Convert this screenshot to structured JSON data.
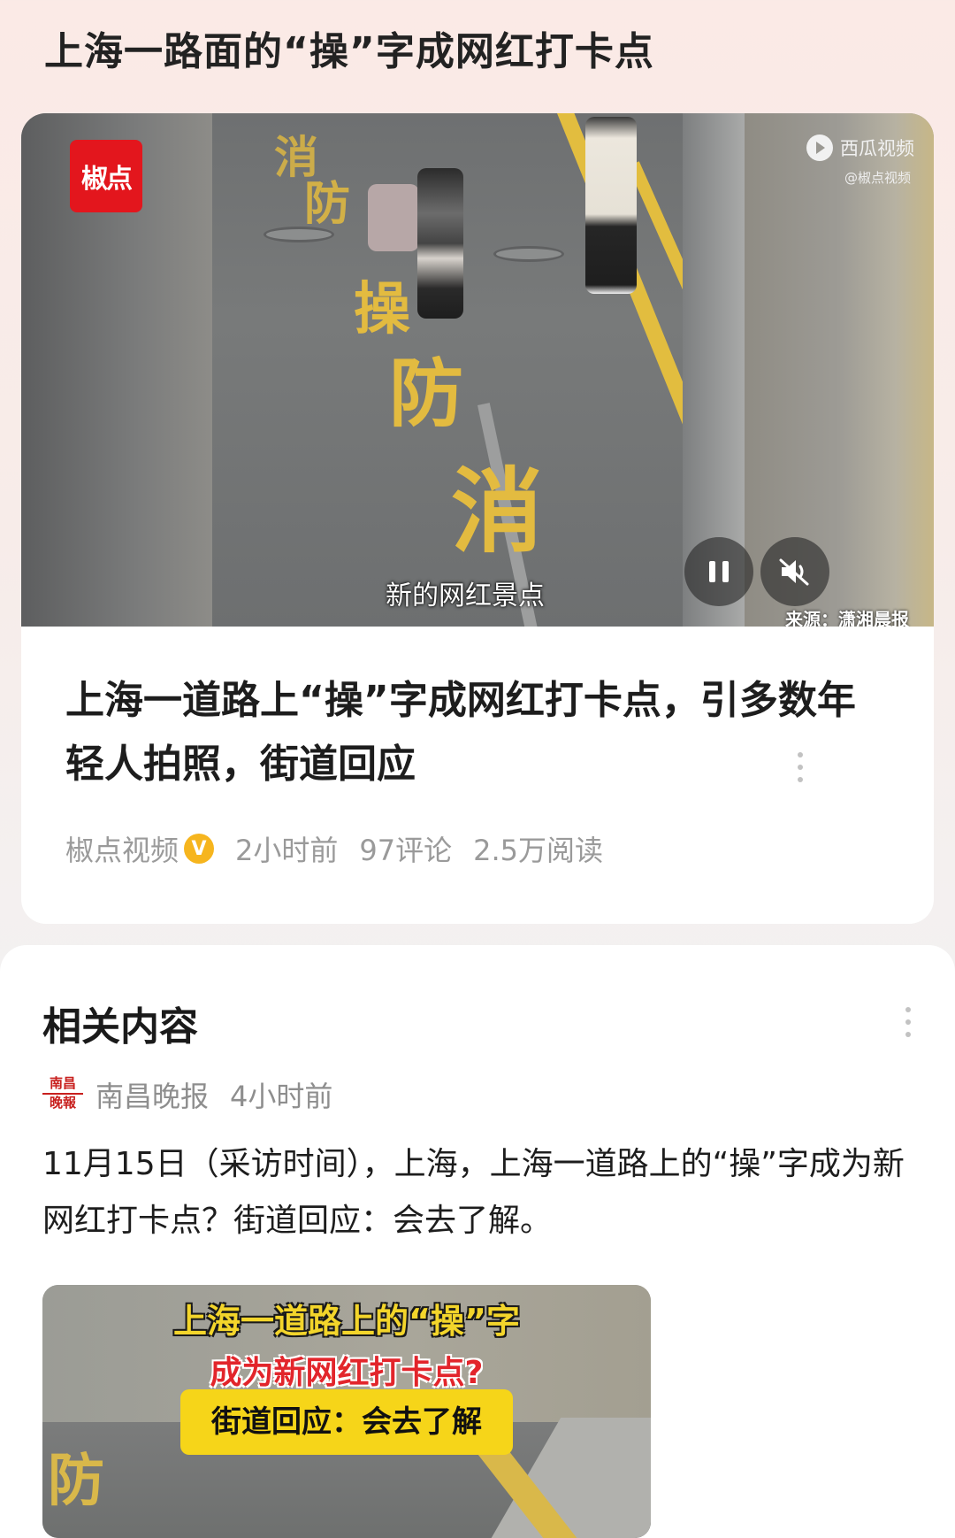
{
  "topic": {
    "title": "上海一路面的“操”字成网红打卡点"
  },
  "main_card": {
    "video": {
      "channel_logo_text": "椒点",
      "platform_name": "西瓜视频",
      "platform_handle": "@椒点视频",
      "subtitle": "新的网红景点",
      "source": "来源：潇湘晨报",
      "road_characters": [
        "操",
        "防",
        "消"
      ],
      "pause_icon": "pause-icon",
      "mute_icon": "speaker-muted-icon"
    },
    "headline": "上海一道路上“操”字成网红打卡点，引多数年轻人拍照，街道回应",
    "author": "椒点视频",
    "verified_badge": "V",
    "time": "2小时前",
    "comments": "97评论",
    "reads": "2.5万阅读"
  },
  "related": {
    "heading": "相关内容",
    "source_logo_text": [
      "南昌",
      "晚報"
    ],
    "source_name": "南昌晚报",
    "time": "4小时前",
    "text": "11月15日（采访时间），上海，上海一道路上的“操”字成为新网红打卡点？街道回应：会去了解。",
    "thumbnail": {
      "line1": "上海一道路上的“操”字",
      "line2": "成为新网红打卡点?",
      "line3": "街道回应：会去了解",
      "road_char": "防"
    }
  },
  "colors": {
    "accent_red": "#e3161d",
    "road_yellow": "#e2bd3f",
    "verified_badge": "#f6b51e"
  }
}
